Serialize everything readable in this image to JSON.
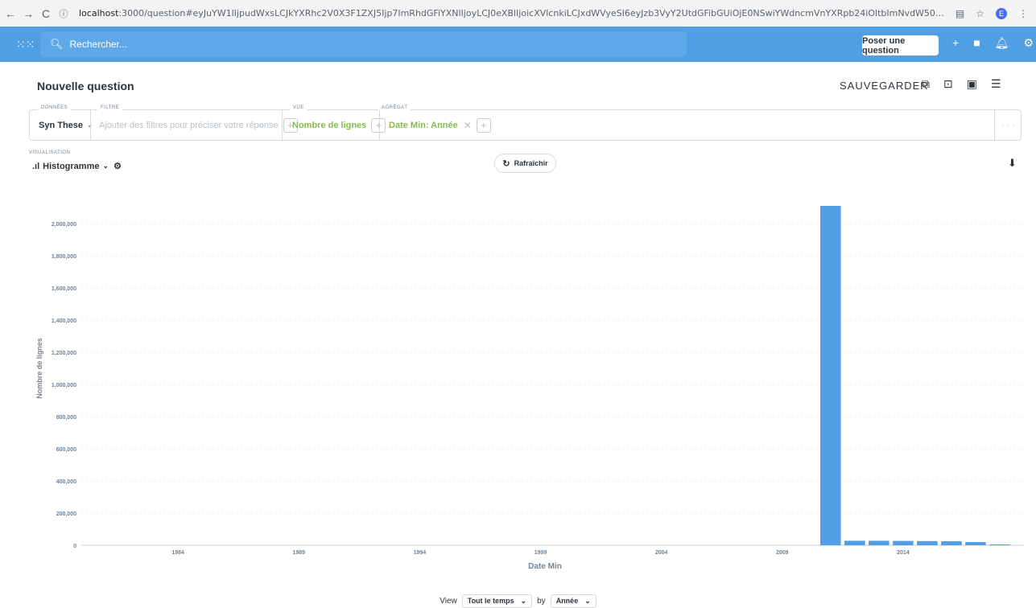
{
  "browser": {
    "url_host": "localhost",
    "url_rest": ":3000/question#eyJuYW1lIjpudWxsLCJkYXRhc2V0X3F1ZXJ5Ijp7ImRhdGFiYXNlIjoyLCJ0eXBlIjoicXVlcnkiLCJxdWVyeSI6eyJzb3VyY2UtdGFibGUiOjE0NSwiYWdncmVnYXRpb24iOltbImNvdW50Il1dLCJicmVha291dCI6W1siZGF0ZXRpbWUtZmllbGQiL...",
    "avatar_letter": "E"
  },
  "nav": {
    "search_placeholder": "Rechercher...",
    "ask_button": "Poser une question"
  },
  "question": {
    "title": "Nouvelle question",
    "save_label": "SAUVEGARDER"
  },
  "builder": {
    "data_label": "DONNÉES",
    "data_value": "Syn These",
    "filter_label": "FILTRE",
    "filter_placeholder": "Ajouter des filtres pour préciser votre réponse",
    "view_label": "VUE",
    "view_value": "Nombre de lignes",
    "aggregate_label": "AGRÉGAT",
    "aggregate_value": "Date Min: Année",
    "more": "· · ·"
  },
  "visualisation": {
    "label": "VISUALISATION",
    "type": "Histogramme"
  },
  "refresh_label": "Rafraîchir",
  "footer": {
    "view_label": "View",
    "period": "Tout le temps",
    "by_label": "by",
    "unit": "Année"
  },
  "colors": {
    "brand": "#509ee3",
    "bar": "#509ee3",
    "accent_green": "#84bb4c"
  },
  "chart_data": {
    "type": "bar",
    "xlabel": "Date Min",
    "ylabel": "Nombre de lignes",
    "ylim": [
      0,
      2200000
    ],
    "yticks": [
      0,
      200000,
      400000,
      600000,
      800000,
      1000000,
      1200000,
      1400000,
      1600000,
      1800000,
      2000000
    ],
    "ytick_labels": [
      "0",
      "200,000",
      "400,000",
      "600,000",
      "800,000",
      "1,000,000",
      "1,200,000",
      "1,400,000",
      "1,600,000",
      "1,800,000",
      "2,000,000"
    ],
    "xticks": [
      1984,
      1989,
      1994,
      1999,
      2004,
      2009,
      2014
    ],
    "xlim": [
      1980,
      2019
    ],
    "categories": [
      2011,
      2012,
      2013,
      2014,
      2015,
      2016,
      2017,
      2018
    ],
    "values": [
      2110000,
      28000,
      28000,
      27000,
      26000,
      25000,
      20000,
      5000
    ],
    "grid": true
  }
}
